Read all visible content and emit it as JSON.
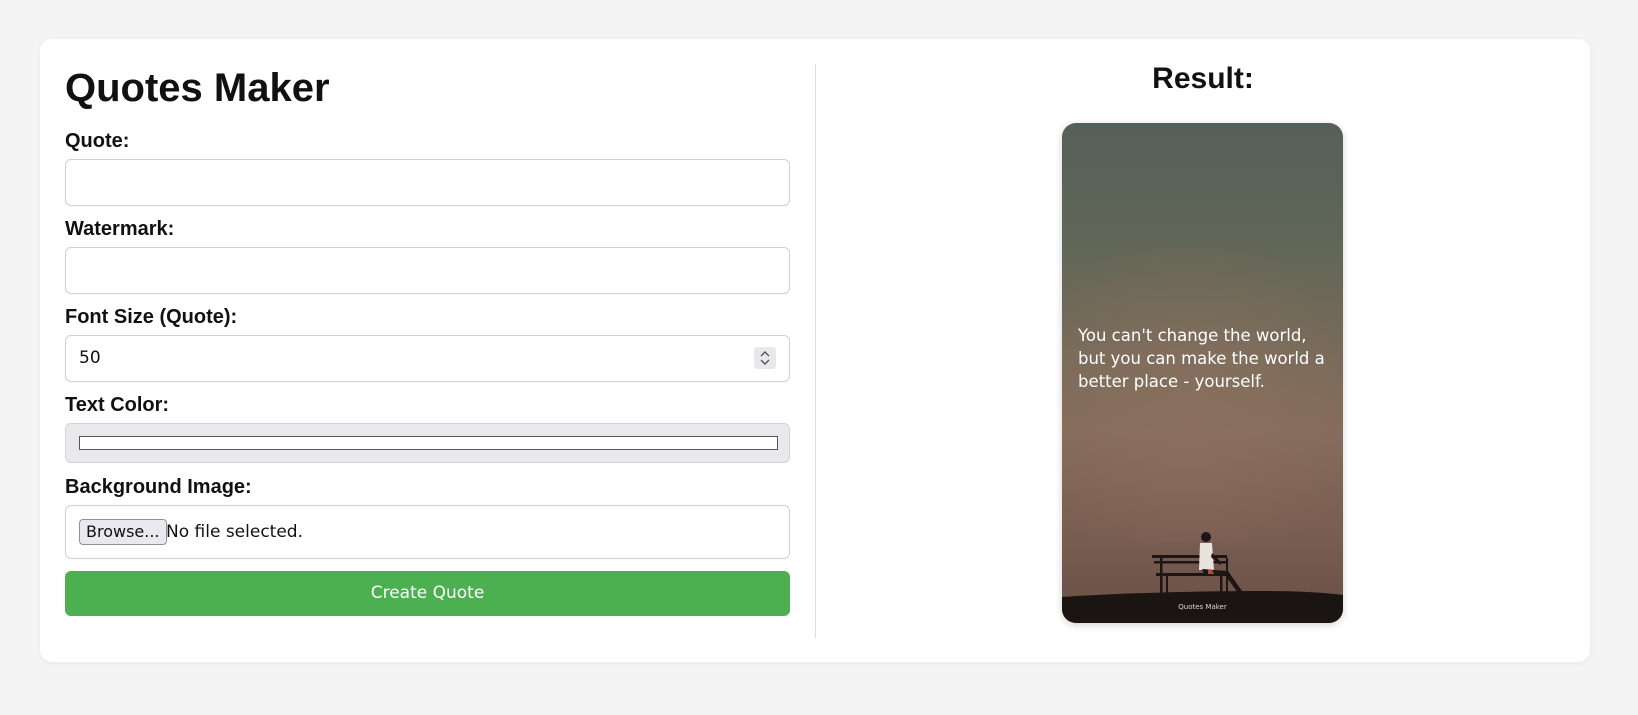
{
  "form": {
    "title": "Quotes Maker",
    "quote_label": "Quote:",
    "quote_value": "",
    "watermark_label": "Watermark:",
    "watermark_value": "",
    "font_size_label": "Font Size (Quote):",
    "font_size_value": "50",
    "text_color_label": "Text Color:",
    "text_color_value": "#ffffff",
    "background_label": "Background Image:",
    "browse_label": "Browse...",
    "file_status": "No file selected.",
    "create_button_label": "Create Quote",
    "button_color": "#4caf50"
  },
  "result": {
    "heading": "Result:",
    "quote_text": "You can't change the world, but you can make the world a better place - yourself.",
    "watermark_text": "Quotes Maker",
    "background_image": "silhouette of a person sitting on a bench on a hilltop under a hazy dusk sky"
  }
}
